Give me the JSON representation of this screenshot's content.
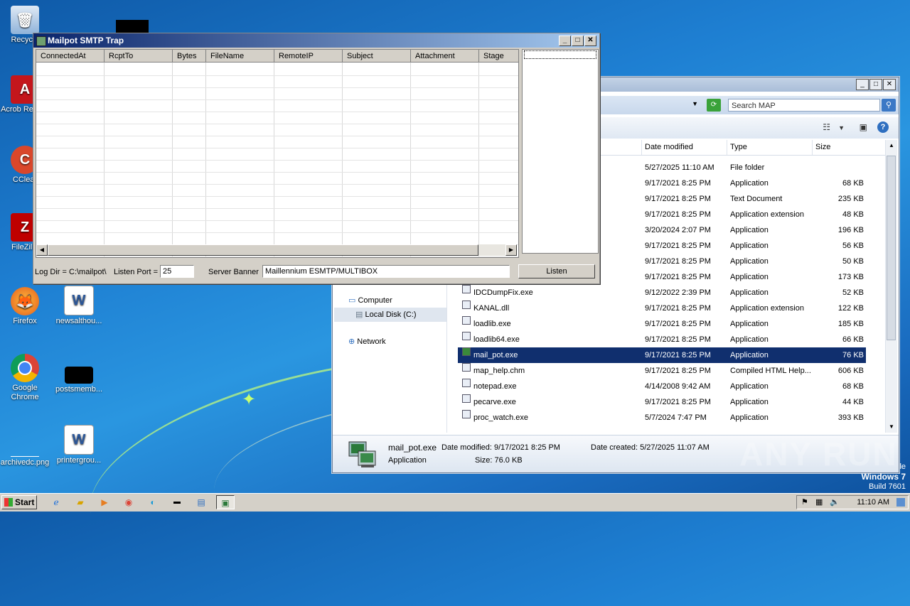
{
  "desktop": {
    "icons": [
      {
        "label": "Recycle",
        "icon": "recycle-bin-icon"
      },
      {
        "label": "Acrob Reader",
        "icon": "acrobat-reader-icon"
      },
      {
        "label": "CClear",
        "icon": "ccleaner-icon"
      },
      {
        "label": "FileZilla",
        "icon": "filezilla-icon"
      },
      {
        "label": "Firefox",
        "icon": "firefox-icon"
      },
      {
        "label": "newsalthou...",
        "icon": "word-document-icon"
      },
      {
        "label": "Google Chrome",
        "icon": "chrome-icon"
      },
      {
        "label": "postsmemb...",
        "icon": "image-file-icon"
      },
      {
        "label": "archivedc.png",
        "icon": "image-file-icon"
      },
      {
        "label": "printergrou...",
        "icon": "word-document-icon"
      }
    ],
    "watermark": "ANY RUN",
    "os_line1": "Windows 7",
    "os_line2": "Build 7601",
    "os_fragment": "le"
  },
  "mailpot": {
    "title": "Mailpot SMTP Trap",
    "columns": [
      "ConnectedAt",
      "RcptTo",
      "Bytes",
      "FileName",
      "RemoteIP",
      "Subject",
      "Attachment",
      "Stage"
    ],
    "log_dir": "Log Dir = C:\\mailpot\\",
    "listen_port_label": "Listen Port =",
    "listen_port_value": "25",
    "server_banner_label": "Server Banner",
    "server_banner_value": "Maillennium ESMTP/MULTIBOX",
    "listen_button": "Listen"
  },
  "explorer": {
    "search_placeholder": "Search MAP",
    "columns": {
      "date": "Date modified",
      "type": "Type",
      "size": "Size"
    },
    "nav": [
      {
        "label": "Computer",
        "icon": "computer-icon"
      },
      {
        "label": "Local Disk (C:)",
        "icon": "disk-icon"
      },
      {
        "label": "Network",
        "icon": "network-icon"
      }
    ],
    "files": [
      {
        "name": "",
        "date": "5/27/2025 11:10 AM",
        "type": "File folder",
        "size": ""
      },
      {
        "name": "",
        "date": "9/17/2021 8:25 PM",
        "type": "Application",
        "size": "68 KB"
      },
      {
        "name": "",
        "date": "9/17/2021 8:25 PM",
        "type": "Text Document",
        "size": "235 KB"
      },
      {
        "name": "",
        "date": "9/17/2021 8:25 PM",
        "type": "Application extension",
        "size": "48 KB"
      },
      {
        "name": "",
        "date": "3/20/2024 2:07 PM",
        "type": "Application",
        "size": "196 KB"
      },
      {
        "name": "",
        "date": "9/17/2021 8:25 PM",
        "type": "Application",
        "size": "56 KB"
      },
      {
        "name": "",
        "date": "9/17/2021 8:25 PM",
        "type": "Application",
        "size": "50 KB"
      },
      {
        "name": "",
        "date": "9/17/2021 8:25 PM",
        "type": "Application",
        "size": "173 KB"
      },
      {
        "name": "IDCDumpFix.exe",
        "date": "9/12/2022 2:39 PM",
        "type": "Application",
        "size": "52 KB"
      },
      {
        "name": "KANAL.dll",
        "date": "9/17/2021 8:25 PM",
        "type": "Application extension",
        "size": "122 KB"
      },
      {
        "name": "loadlib.exe",
        "date": "9/17/2021 8:25 PM",
        "type": "Application",
        "size": "185 KB"
      },
      {
        "name": "loadlib64.exe",
        "date": "9/17/2021 8:25 PM",
        "type": "Application",
        "size": "66 KB"
      },
      {
        "name": "mail_pot.exe",
        "date": "9/17/2021 8:25 PM",
        "type": "Application",
        "size": "76 KB",
        "selected": true
      },
      {
        "name": "map_help.chm",
        "date": "9/17/2021 8:25 PM",
        "type": "Compiled HTML Help...",
        "size": "606 KB"
      },
      {
        "name": "notepad.exe",
        "date": "4/14/2008 9:42 AM",
        "type": "Application",
        "size": "68 KB"
      },
      {
        "name": "pecarve.exe",
        "date": "9/17/2021 8:25 PM",
        "type": "Application",
        "size": "44 KB"
      },
      {
        "name": "proc_watch.exe",
        "date": "5/7/2024 7:47 PM",
        "type": "Application",
        "size": "393 KB"
      }
    ],
    "status": {
      "name": "mail_pot.exe",
      "date_modified": "Date modified: 9/17/2021 8:25 PM",
      "date_created": "Date created: 5/27/2025 11:07 AM",
      "type": "Application",
      "size": "Size: 76.0 KB"
    }
  },
  "taskbar": {
    "start": "Start",
    "clock": "11:10 AM"
  },
  "colors": {
    "selection": "#102f6e",
    "titlebar_start": "#0a246a",
    "titlebar_end": "#a6caf0"
  }
}
